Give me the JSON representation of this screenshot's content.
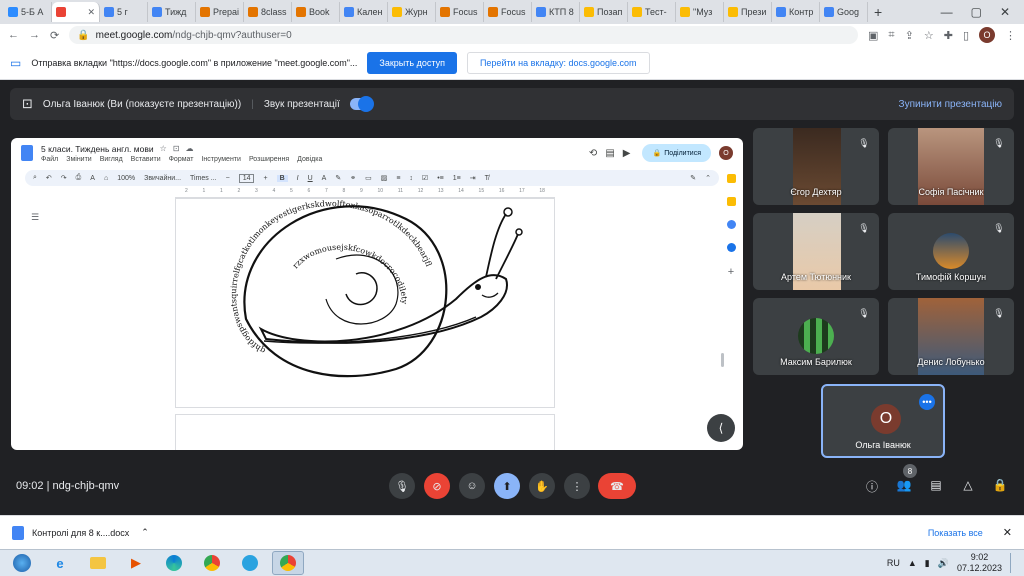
{
  "browser": {
    "tabs": [
      {
        "label": "5-Б А",
        "color": "#2d8cff"
      },
      {
        "label": "",
        "color": "#ea4335",
        "active": true
      },
      {
        "label": "5 г",
        "color": "#4285f4"
      },
      {
        "label": "Тижд",
        "color": "#4285f4"
      },
      {
        "label": "Prepai",
        "color": "#e37400"
      },
      {
        "label": "8class",
        "color": "#e37400"
      },
      {
        "label": "Book",
        "color": "#e37400"
      },
      {
        "label": "Кален",
        "color": "#4285f4"
      },
      {
        "label": "Журн",
        "color": "#fbbc04"
      },
      {
        "label": "Focus",
        "color": "#e37400"
      },
      {
        "label": "Focus",
        "color": "#e37400"
      },
      {
        "label": "КТП 8",
        "color": "#4285f4"
      },
      {
        "label": "Позап",
        "color": "#fbbc04"
      },
      {
        "label": "Тест-",
        "color": "#fbbc04"
      },
      {
        "label": "\"Муз",
        "color": "#fbbc04"
      },
      {
        "label": "Прези",
        "color": "#fbbc04"
      },
      {
        "label": "Контр",
        "color": "#4285f4"
      },
      {
        "label": "Goog",
        "color": "#4285f4"
      }
    ],
    "new_tab": "+",
    "url_host": "meet.google.com",
    "url_path": "/ndg-chjb-qmv?authuser=0",
    "profile_initial": "О"
  },
  "infobar": {
    "text": "Отправка вкладки \"https://docs.google.com\" в приложение \"meet.google.com\"...",
    "share_access": "Закрыть доступ",
    "go_to_tab": "Перейти на вкладку: docs.google.com"
  },
  "presenting": {
    "status": "Ольга Іванюк (Ви (показуєте презентацію))",
    "sound_label": "Звук презентації",
    "stop_label": "Зупинити презентацію"
  },
  "docs": {
    "title": "5 класи. Тиждень англ. мови",
    "menu": [
      "Файл",
      "Змінити",
      "Вигляд",
      "Вставити",
      "Формат",
      "Інструменти",
      "Розширення",
      "Довідка"
    ],
    "share": "Поділитися",
    "avatar": "О",
    "zoom": "100%",
    "style": "Звичайни...",
    "font": "Times ...",
    "font_size": "14",
    "ruler_ticks": [
      "2",
      "1",
      "1",
      "2",
      "3",
      "4",
      "5",
      "6",
      "7",
      "8",
      "9",
      "10",
      "11",
      "12",
      "13",
      "14",
      "15",
      "16",
      "17",
      "18"
    ],
    "snail_outer": "qhfdogpswantsquirrelfgcatkotlmonkeyestigerkskdwolftoxkasoparrotlkdeckbearjfl",
    "snail_inner": "rzxwomousejskfcowkdocrocodilety"
  },
  "participants": [
    {
      "name": "Єгор Дехтяр"
    },
    {
      "name": "Софія Пасічник"
    },
    {
      "name": "Артем Тютюнник"
    },
    {
      "name": "Тимофій Коршун"
    },
    {
      "name": "Максим Барилюк"
    },
    {
      "name": "Денис Лобунько"
    }
  ],
  "self_tile": {
    "initial": "О",
    "name": "Ольга Іванюк"
  },
  "meet": {
    "time": "09:02",
    "code": "ndg-chjb-qmv",
    "people_count": "8"
  },
  "download": {
    "file": "Контролі для 8 к....docx",
    "show_all": "Показать все"
  },
  "taskbar": {
    "lang": "RU",
    "time": "9:02",
    "date": "07.12.2023"
  }
}
